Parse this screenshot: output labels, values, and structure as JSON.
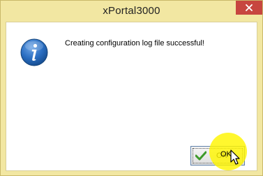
{
  "window": {
    "title": "xPortal3000"
  },
  "dialog": {
    "message": "Creating configuration log file successful!",
    "icon": "info-icon"
  },
  "buttons": {
    "ok_label": "OK"
  },
  "titlebar": {
    "close_icon": "close-icon"
  },
  "colors": {
    "frame": "#f2e7a2",
    "close": "#c7463f",
    "info_blue": "#1c5fa8",
    "highlight": "#fff500"
  }
}
